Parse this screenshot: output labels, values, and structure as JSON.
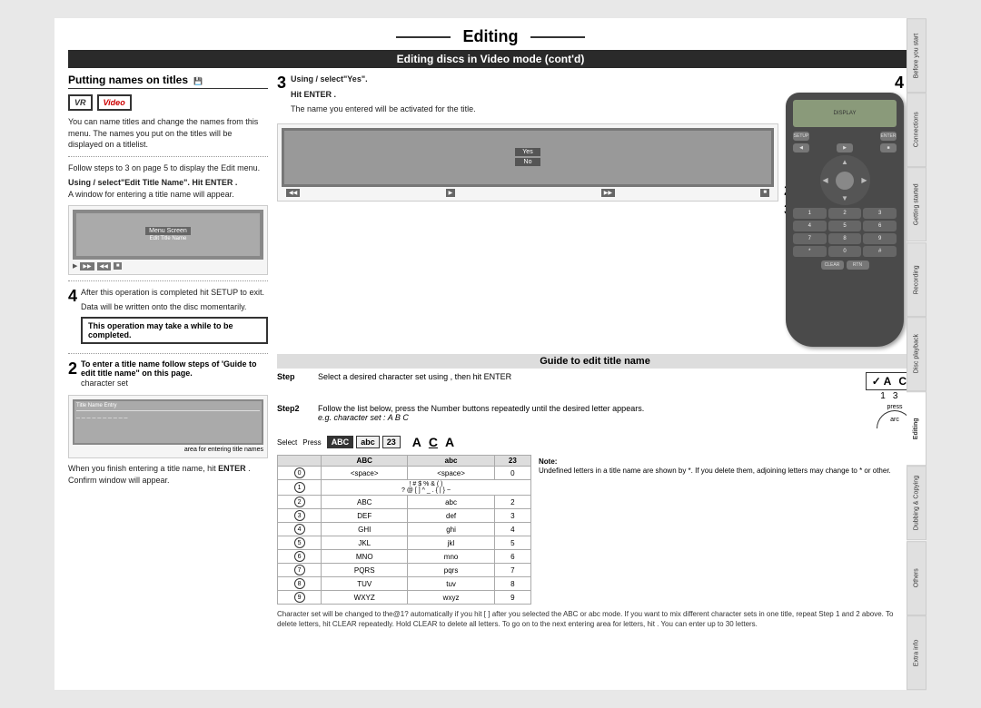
{
  "page": {
    "title": "Editing",
    "subtitle": "Editing discs in Video mode (cont'd)",
    "section": "Putting names on titles"
  },
  "tabs": [
    {
      "label": "Before you start",
      "active": false
    },
    {
      "label": "Connections",
      "active": false
    },
    {
      "label": "Getting started",
      "active": false
    },
    {
      "label": "Recording",
      "active": false
    },
    {
      "label": "Disc playback",
      "active": false
    },
    {
      "label": "Editing",
      "active": true
    },
    {
      "label": "Dubbing & Copying",
      "active": false
    },
    {
      "label": "Others",
      "active": false
    },
    {
      "label": "Extra info",
      "active": false
    }
  ],
  "left_col": {
    "intro_text": "You can name titles and change the names from this menu. The names you put on the titles will be displayed on a titlelist.",
    "step2_text": "Follow steps to 3 on page 5 to display the Edit menu.",
    "step2b_text": "Using / select \"Edit Title Name\". Hit ENTER . A window for entering a title name will appear.",
    "step2_guide_title": "Guide to edit title name",
    "step2_guide_text": "To enter a title name follow steps of 'Guide to edit title name\" on this page.",
    "step2_guide_char": "character set",
    "step4_text": "After this operation is completed hit SETUP to exit.",
    "step4_note": "Data will be written onto the disc momentarily.",
    "warning_text": "This operation may take a while to be completed."
  },
  "right_col": {
    "step3_text1": "Using / select \"Yes\".",
    "step3_text2": "Hit ENTER .",
    "step3_text3": "The name you entered will be activated for the title.",
    "step3_num": "3",
    "guide_section": {
      "title": "Guide to edit title name",
      "step1_label": "Step",
      "step1_text": "Select a desired character set using , then hit ENTER",
      "step1_chars": [
        "A",
        "C"
      ],
      "step1_nums": [
        "1",
        "3"
      ],
      "step2_label": "Step2",
      "step2_text": "Follow the list below, press the Number buttons repeatedly until the desired letter appears.",
      "step2_example": "e.g. character set : A B C",
      "char_select": {
        "select_label": "Select",
        "press_label": "Press",
        "options": [
          {
            "label": "ABC",
            "active": false
          },
          {
            "label": "abc",
            "active": false
          },
          {
            "label": "23",
            "active": false
          }
        ]
      },
      "char_display": [
        "A",
        "C",
        "A"
      ],
      "note_label": "Note:",
      "note_text": "Undefined letters in a title name are shown by *. If you delete them, adjoining letters may change to * or other.",
      "char_rows": [
        {
          "btn": "0",
          "ABC": "<space>",
          "abc": "<space>",
          "n23": "0",
          "extra": "<space>"
        },
        {
          "btn": "1",
          "ABC": "! # $ % & ( )",
          "abc": "? @ [ ] ^ _ . { | } ~",
          "n23": ""
        },
        {
          "btn": "2",
          "ABC": "ABC",
          "abc": "abc",
          "n23": "2"
        },
        {
          "btn": "3",
          "ABC": "DEF",
          "abc": "def",
          "n23": "3"
        },
        {
          "btn": "4",
          "ABC": "GHI",
          "abc": "ghi",
          "n23": "4"
        },
        {
          "btn": "5",
          "ABC": "JKL",
          "abc": "jkl",
          "n23": "5"
        },
        {
          "btn": "6",
          "ABC": "MNO",
          "abc": "mno",
          "n23": "6"
        },
        {
          "btn": "7",
          "ABC": "PQRS",
          "abc": "pqrs",
          "n23": "7"
        },
        {
          "btn": "8",
          "ABC": "TUV",
          "abc": "tuv",
          "n23": "8"
        },
        {
          "btn": "9",
          "ABC": "WXYZ",
          "abc": "wxyz",
          "n23": "9"
        }
      ],
      "bottom_text": "Character set will be changed to the@1? automatically if you hit [  ] after you selected the ABC or abc mode. If you want to mix different character sets in one title, repeat Step 1 and 2 above. To delete letters, hit CLEAR repeatedly. Hold CLEAR to delete all letters. To go on to the next entering area for letters, hit . You can enter up to 30 letters."
    }
  }
}
